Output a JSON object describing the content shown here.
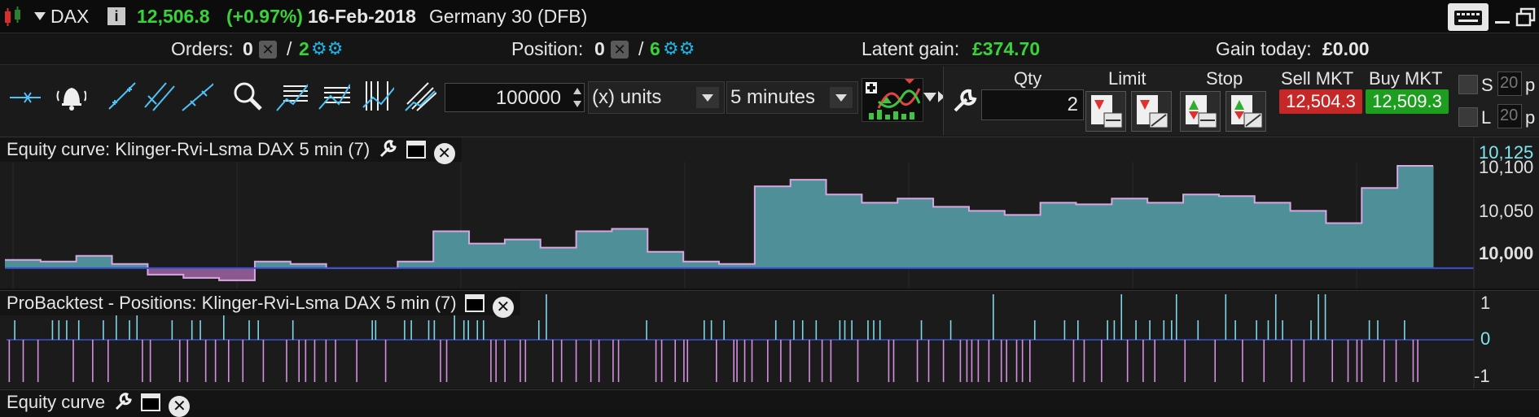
{
  "header": {
    "symbol": "DAX",
    "info_glyph": "i",
    "price": "12,506.8",
    "change": "(+0.97%)",
    "date": "16-Feb-2018",
    "instrument": "Germany 30 (DFB)"
  },
  "infobar": {
    "orders_label": "Orders:",
    "orders_count": "0",
    "orders_sep": "/",
    "orders_pending": "2",
    "position_label": "Position:",
    "position_count": "0",
    "position_sep": "/",
    "position_pending": "6",
    "latent_label": "Latent gain:",
    "latent_value": "£374.70",
    "today_label": "Gain today:",
    "today_value": "£0.00"
  },
  "toolbar": {
    "quantity_value": "100000",
    "units_label": "(x) units",
    "interval_label": "5 minutes"
  },
  "order_panel": {
    "qty_label": "Qty",
    "qty_value": "2",
    "limit_label": "Limit",
    "stop_label": "Stop",
    "sell_label": "Sell MKT",
    "buy_label": "Buy MKT",
    "sell_price": "12,504.3",
    "buy_price": "12,509.3",
    "s_label": "S",
    "s_value": "20",
    "s_suffix": "p",
    "l_label": "L",
    "l_value": "20",
    "l_suffix": "p",
    "sell_color": "#c62828",
    "buy_color": "#1e9e1e"
  },
  "panels": {
    "equity_title": "Equity curve: Klinger-Rvi-Lsma DAX 5 min (7)",
    "positions_title": "ProBacktest - Positions: Klinger-Rvi-Lsma DAX 5 min (7)",
    "equity2_title": "Equity curve"
  },
  "chart_data": [
    {
      "type": "area",
      "title": "Equity curve: Klinger-Rvi-Lsma DAX 5 min (7)",
      "y_tick_labels": [
        "10,125",
        "10,100",
        "10,050",
        "10,000"
      ],
      "ylim": [
        9975,
        10130
      ],
      "baseline": 10000,
      "x_count": 40,
      "values": [
        10010,
        10008,
        10015,
        10005,
        9992,
        9988,
        9985,
        10008,
        10005,
        10000,
        10000,
        10008,
        10045,
        10030,
        10035,
        10025,
        10045,
        10048,
        10020,
        10008,
        10005,
        10100,
        10108,
        10090,
        10080,
        10085,
        10075,
        10070,
        10065,
        10080,
        10078,
        10085,
        10080,
        10090,
        10088,
        10080,
        10070,
        10055,
        10098,
        10125
      ],
      "colors": {
        "fill": "#4f8f98",
        "negative_fill": "#8a5a8e",
        "line": "#d8a6e0",
        "baseline": "#3b4fd6"
      }
    },
    {
      "type": "bar",
      "title": "ProBacktest - Positions: Klinger-Rvi-Lsma DAX 5 min (7)",
      "y_tick_labels": [
        "1",
        "0",
        "-1"
      ],
      "ylim": [
        -1,
        1
      ],
      "x_count": 200,
      "colors": {
        "long": "#7fd6e6",
        "short": "#d58fe0"
      }
    }
  ]
}
